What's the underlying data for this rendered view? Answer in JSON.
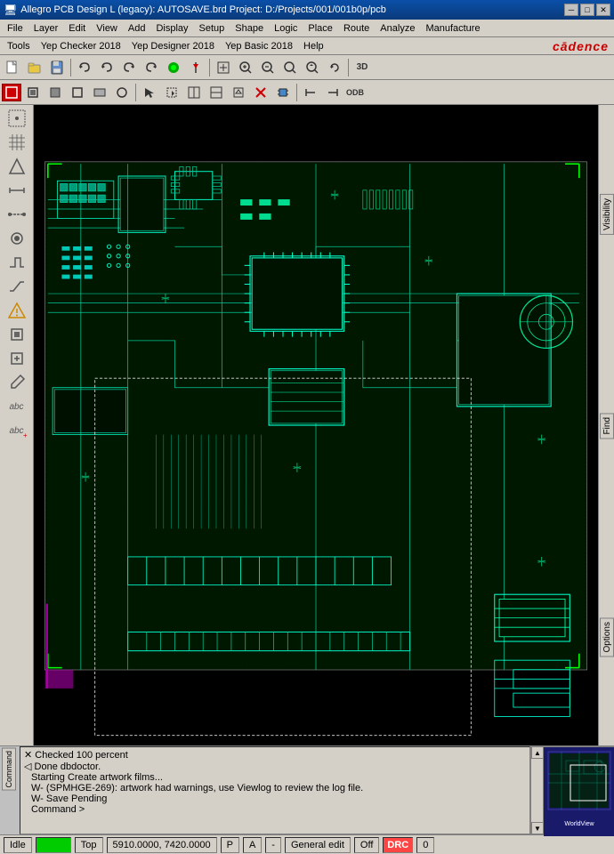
{
  "title": {
    "text": "Allegro PCB Design L (legacy): AUTOSAVE.brd  Project: D:/Projects/001/001b0p/pcb",
    "min_label": "─",
    "max_label": "□",
    "close_label": "✕"
  },
  "menu": {
    "items": [
      "File",
      "Layer",
      "Edit",
      "View",
      "Add",
      "Display",
      "Setup",
      "Shape",
      "Logic",
      "Place",
      "Route",
      "Analyze",
      "Manufacture"
    ]
  },
  "menu2": {
    "items": [
      "Tools",
      "Yep Checker 2018",
      "Yep Designer 2018",
      "Yep Basic 2018",
      "Help"
    ]
  },
  "cadence": {
    "logo": "cādence"
  },
  "toolbar1": {
    "buttons": [
      {
        "icon": "📂",
        "name": "new"
      },
      {
        "icon": "📁",
        "name": "open"
      },
      {
        "icon": "💾",
        "name": "save"
      },
      {
        "icon": "✛",
        "name": "add"
      },
      {
        "icon": "⎘",
        "name": "copy"
      },
      {
        "icon": "✕",
        "name": "delete"
      },
      {
        "icon": "↩",
        "name": "undo1"
      },
      {
        "icon": "↩",
        "name": "undo2"
      },
      {
        "icon": "↪",
        "name": "redo1"
      },
      {
        "icon": "↪",
        "name": "redo2"
      },
      {
        "icon": "●",
        "name": "run"
      },
      {
        "icon": "📌",
        "name": "pin"
      },
      {
        "icon": "⊞",
        "name": "grid1"
      },
      {
        "icon": "⊞",
        "name": "grid2"
      },
      {
        "icon": "🔍",
        "name": "zoom-in1"
      },
      {
        "icon": "🔍",
        "name": "zoom-out1"
      },
      {
        "icon": "🔍",
        "name": "zoom-in2"
      },
      {
        "icon": "🔍",
        "name": "zoom-out2"
      },
      {
        "icon": "↺",
        "name": "rotate"
      },
      {
        "icon": "3D",
        "name": "3d"
      }
    ]
  },
  "toolbar2": {
    "buttons": [
      {
        "icon": "▣",
        "name": "t1"
      },
      {
        "icon": "▣",
        "name": "t2"
      },
      {
        "icon": "▣",
        "name": "t3"
      },
      {
        "icon": "▣",
        "name": "t4"
      },
      {
        "icon": "▣",
        "name": "t5"
      },
      {
        "icon": "◯",
        "name": "t6"
      },
      {
        "icon": "◁",
        "name": "t7"
      },
      {
        "icon": "◻",
        "name": "t8"
      },
      {
        "icon": "◻",
        "name": "t9"
      },
      {
        "icon": "◻",
        "name": "t10"
      },
      {
        "icon": "◻",
        "name": "t11"
      },
      {
        "icon": "◻",
        "name": "t12"
      },
      {
        "icon": "✕",
        "name": "t13"
      },
      {
        "icon": "⊡",
        "name": "t14"
      },
      {
        "icon": "⊣",
        "name": "t15"
      },
      {
        "icon": "⊢",
        "name": "t16"
      },
      {
        "icon": "ODB",
        "name": "odb"
      }
    ]
  },
  "left_toolbar": {
    "buttons": [
      {
        "icon": "⊞",
        "name": "lt1"
      },
      {
        "icon": "⊞",
        "name": "lt2"
      },
      {
        "icon": "⊞",
        "name": "lt3"
      },
      {
        "icon": "⊞",
        "name": "lt4"
      },
      {
        "icon": "⊞",
        "name": "lt5"
      },
      {
        "icon": "⊞",
        "name": "lt6"
      },
      {
        "icon": "⊞",
        "name": "lt7"
      },
      {
        "icon": "⊞",
        "name": "lt8"
      },
      {
        "icon": "△",
        "name": "lt9"
      },
      {
        "icon": "⊞",
        "name": "lt10"
      },
      {
        "icon": "⊞",
        "name": "lt11"
      },
      {
        "icon": "⊞",
        "name": "lt12"
      },
      {
        "icon": "⊞",
        "name": "lt13"
      },
      {
        "icon": "abc",
        "name": "lt14"
      },
      {
        "icon": "abc",
        "name": "lt15"
      }
    ]
  },
  "right_panel": {
    "tabs": [
      "Visibility",
      "Find",
      "Options"
    ]
  },
  "log": {
    "label": "Command",
    "lines": [
      "Checked 100 percent",
      "Done dbdoctor.",
      "Starting Create artwork films...",
      "W- (SPMHGE-269): artwork had warnings, use Viewlog to review the log file.",
      "W- Save Pending",
      "Command >"
    ]
  },
  "status": {
    "idle_label": "Idle",
    "indicator": "",
    "layer": "Top",
    "coords": "5910.0000, 7420.0000",
    "p_flag": "P",
    "a_flag": "A",
    "dash": "-",
    "mode": "General edit",
    "off_label": "Off",
    "drc_label": "DRC",
    "drc_count": "0"
  }
}
